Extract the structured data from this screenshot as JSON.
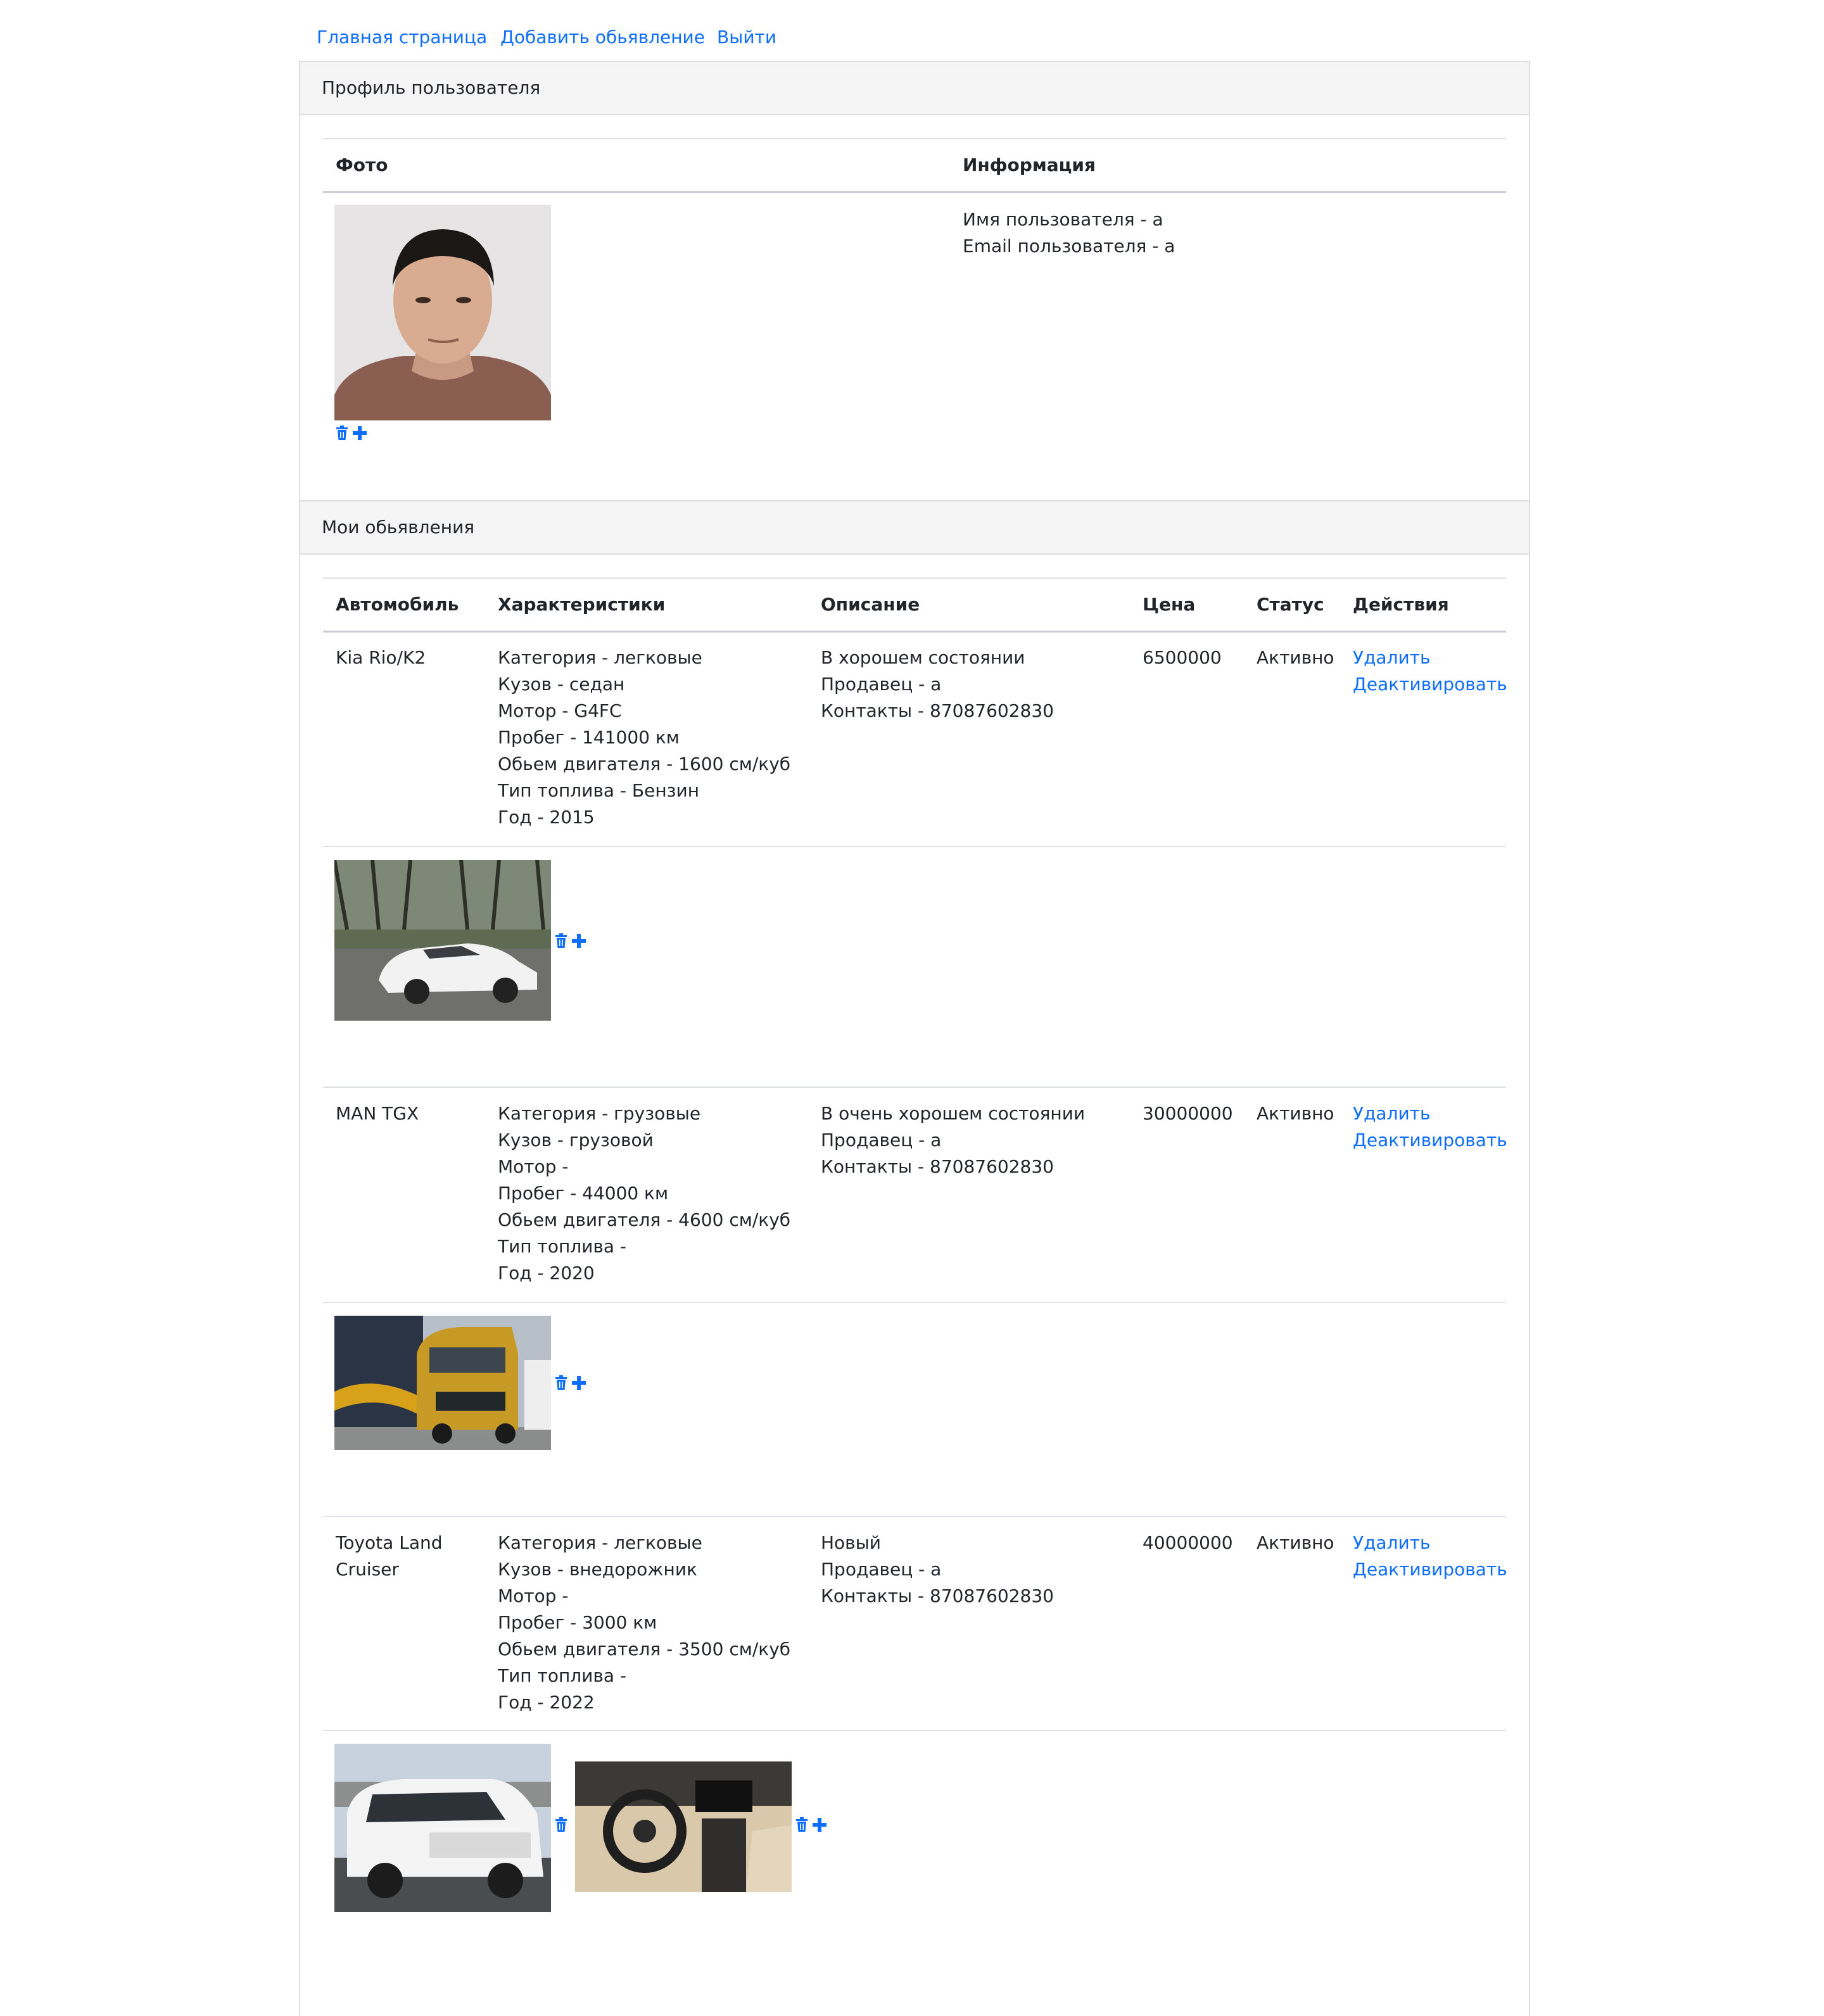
{
  "nav": {
    "home": "Главная страница",
    "add_ad": "Добавить обьявление",
    "logout": "Выйти"
  },
  "profile": {
    "header": "Профиль пользователя",
    "col_photo": "Фото",
    "col_info": "Информация",
    "username_line": "Имя пользователя - a",
    "email_line": "Email пользователя - a"
  },
  "ads": {
    "header": "Мои обьявления",
    "columns": {
      "car": "Автомобиль",
      "specs": "Характеристики",
      "description": "Описание",
      "price": "Цена",
      "status": "Статус",
      "actions": "Действия"
    },
    "delete_label": "Удалить",
    "deactivate_label": "Деактивировать",
    "items": [
      {
        "car": "Kia Rio/K2",
        "specs": [
          "Категория - легковые",
          "Кузов - седан",
          "Мотор - G4FC",
          "Пробег - 141000 км",
          "Обьем двигателя - 1600 см/куб",
          "Тип топлива - Бензин",
          "Год - 2015"
        ],
        "description": [
          "В хорошем состоянии",
          "Продавец - a",
          "Контакты - 87087602830"
        ],
        "price": "6500000",
        "status": "Активно"
      },
      {
        "car": "MAN TGX",
        "specs": [
          "Категория - грузовые",
          "Кузов - грузовой",
          "Мотор -",
          "Пробег - 44000 км",
          "Обьем двигателя - 4600 см/куб",
          "Тип топлива -",
          "Год - 2020"
        ],
        "description": [
          "В очень хорошем состоянии",
          "Продавец - a",
          "Контакты - 87087602830"
        ],
        "price": "30000000",
        "status": "Активно"
      },
      {
        "car_line1": "Toyota Land",
        "car_line2": "Cruiser",
        "specs": [
          "Категория - легковые",
          "Кузов - внедорожник",
          "Мотор -",
          "Пробег - 3000 км",
          "Обьем двигателя - 3500 см/куб",
          "Тип топлива -",
          "Год - 2022"
        ],
        "description": [
          "Новый",
          "Продавец - a",
          "Контакты - 87087602830"
        ],
        "price": "40000000",
        "status": "Активно"
      }
    ]
  },
  "icons": {
    "trash": "trash-icon",
    "plus": "plus-icon"
  },
  "colors": {
    "link": "#0d6efd",
    "header_bg": "#f5f5f5",
    "border": "#dddddd"
  }
}
